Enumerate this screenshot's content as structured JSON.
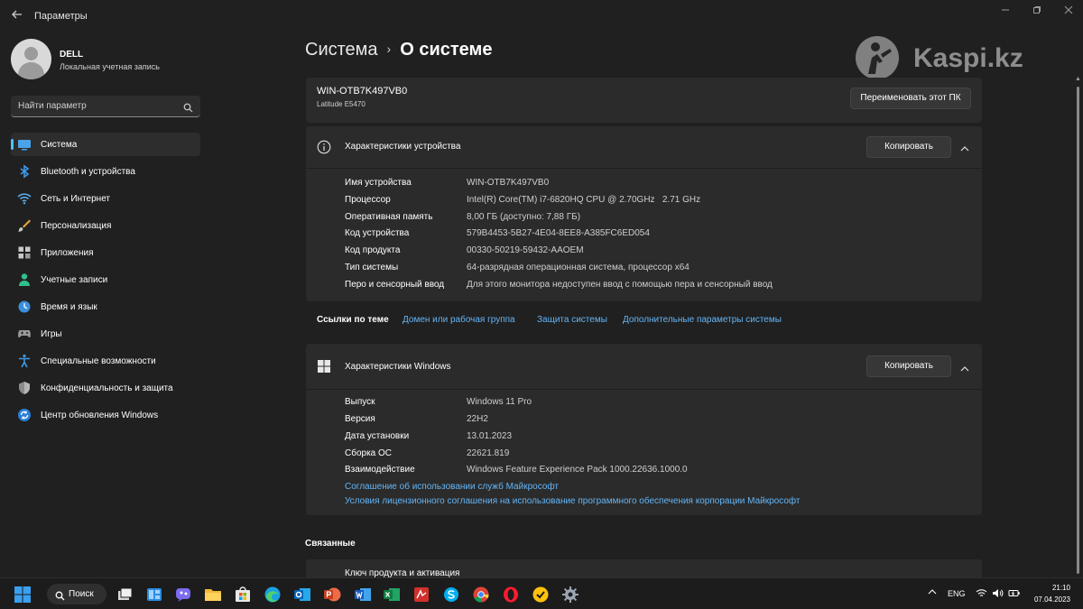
{
  "window": {
    "title": "Параметры"
  },
  "profile": {
    "name": "DELL",
    "account_type": "Локальная учетная запись"
  },
  "search": {
    "placeholder": "Найти параметр"
  },
  "sidebar": {
    "items": [
      {
        "label": "Система",
        "icon": "system-icon",
        "active": true
      },
      {
        "label": "Bluetooth и устройства",
        "icon": "bluetooth-icon"
      },
      {
        "label": "Сеть и Интернет",
        "icon": "wifi-icon"
      },
      {
        "label": "Персонализация",
        "icon": "brush-icon"
      },
      {
        "label": "Приложения",
        "icon": "apps-icon"
      },
      {
        "label": "Учетные записи",
        "icon": "accounts-icon"
      },
      {
        "label": "Время и язык",
        "icon": "globe-clock-icon"
      },
      {
        "label": "Игры",
        "icon": "gamepad-icon"
      },
      {
        "label": "Специальные возможности",
        "icon": "accessibility-icon"
      },
      {
        "label": "Конфиденциальность и защита",
        "icon": "shield-icon"
      },
      {
        "label": "Центр обновления Windows",
        "icon": "update-icon"
      }
    ]
  },
  "breadcrumb": {
    "parent": "Система",
    "separator": "›",
    "current": "О системе"
  },
  "pc": {
    "name": "WIN-OTB7K497VB0",
    "model": "Latitude E5470",
    "rename_button": "Переименовать этот ПК"
  },
  "device_specs": {
    "title": "Характеристики устройства",
    "copy_button": "Копировать",
    "rows": [
      {
        "key": "Имя устройства",
        "value": "WIN-OTB7K497VB0"
      },
      {
        "key": "Процессор",
        "value": "Intel(R) Core(TM) i7-6820HQ CPU @ 2.70GHz   2.71 GHz"
      },
      {
        "key": "Оперативная память",
        "value": "8,00 ГБ (доступно: 7,88 ГБ)"
      },
      {
        "key": "Код устройства",
        "value": "579B4453-5B27-4E04-8EE8-A385FC6ED054"
      },
      {
        "key": "Код продукта",
        "value": "00330-50219-59432-AAOEM"
      },
      {
        "key": "Тип системы",
        "value": "64-разрядная операционная система, процессор x64"
      },
      {
        "key": "Перо и сенсорный ввод",
        "value": "Для этого монитора недоступен ввод с помощью пера и сенсорный ввод"
      }
    ]
  },
  "related_links": {
    "title": "Ссылки по теме",
    "links": [
      "Домен или рабочая группа",
      "Защита системы",
      "Дополнительные параметры системы"
    ]
  },
  "windows_specs": {
    "title": "Характеристики Windows",
    "copy_button": "Копировать",
    "rows": [
      {
        "key": "Выпуск",
        "value": "Windows 11 Pro"
      },
      {
        "key": "Версия",
        "value": "22H2"
      },
      {
        "key": "Дата установки",
        "value": "13.01.2023"
      },
      {
        "key": "Сборка ОС",
        "value": "22621.819"
      },
      {
        "key": "Взаимодействие",
        "value": "Windows Feature Experience Pack 1000.22636.1000.0"
      }
    ],
    "links": [
      "Соглашение об использовании служб Майкрософт",
      "Условия лицензионного соглашения на использование программного обеспечения корпорации Майкрософт"
    ]
  },
  "related": {
    "title": "Связанные",
    "first_item": "Ключ продукта и активация"
  },
  "watermark": {
    "text": "Kaspi.kz"
  },
  "taskbar": {
    "search_label": "Поиск",
    "language": "ENG",
    "time": "21:10",
    "date": "07.04.2023"
  },
  "colors": {
    "accent": "#4cc2ff",
    "link": "#64b5f6",
    "background": "#202020",
    "card": "#2b2b2b"
  }
}
